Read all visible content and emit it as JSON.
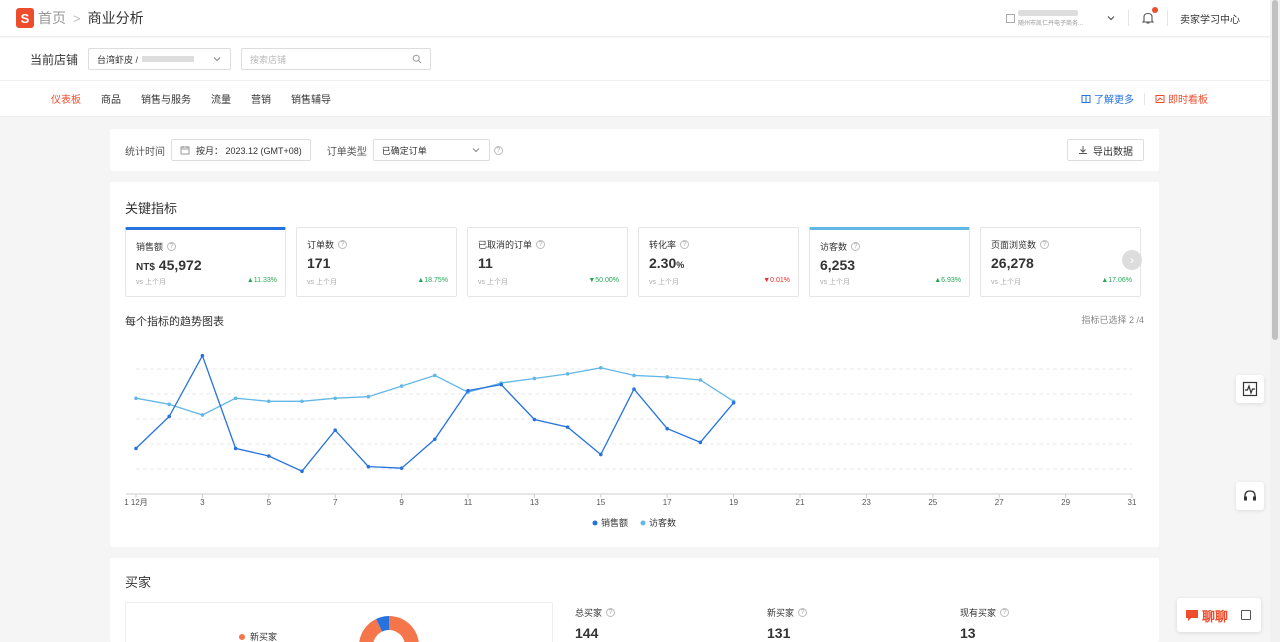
{
  "header": {
    "logo_letter": "S",
    "breadcrumb_home": "首页",
    "breadcrumb_current": "商业分析",
    "shop_subtitle": "随州市凯仁丹电子商务...",
    "learning_center": "卖家学习中心"
  },
  "store": {
    "label": "当前店铺",
    "selected": "台湾虾皮 /",
    "search_placeholder": "搜索店铺"
  },
  "tabs": [
    {
      "label": "仪表板",
      "active": true
    },
    {
      "label": "商品"
    },
    {
      "label": "销售与服务"
    },
    {
      "label": "流量"
    },
    {
      "label": "营销"
    },
    {
      "label": "销售辅导"
    }
  ],
  "tab_links": {
    "learn_more": "了解更多",
    "realtime": "即时看板"
  },
  "filter": {
    "time_label": "统计时间",
    "date_value": "按月： 2023.12 (GMT+08)",
    "order_type_label": "订单类型",
    "order_type_value": "已确定订单",
    "export_label": "导出数据"
  },
  "key_metrics": {
    "title": "关键指标",
    "vs_label": "vs 上个月",
    "items": [
      {
        "label": "销售额",
        "prefix": "NT$",
        "value": "45,972",
        "change": "11.33%",
        "direction": "up",
        "selected": "dark"
      },
      {
        "label": "订单数",
        "prefix": "",
        "value": "171",
        "change": "18.75%",
        "direction": "up"
      },
      {
        "label": "已取消的订单",
        "prefix": "",
        "value": "11",
        "change": "50.00%",
        "direction": "down-good"
      },
      {
        "label": "转化率",
        "prefix": "",
        "value": "2.30",
        "unit": "%",
        "change": "0.01%",
        "direction": "down"
      },
      {
        "label": "访客数",
        "prefix": "",
        "value": "6,253",
        "change": "6.93%",
        "direction": "up",
        "selected": "light"
      },
      {
        "label": "页面浏览数",
        "prefix": "",
        "value": "26,278",
        "change": "17.06%",
        "direction": "up"
      }
    ]
  },
  "trend": {
    "title": "每个指标的趋势图表",
    "selected_count": "指标已选择 2 /4"
  },
  "chart_data": {
    "type": "line",
    "x_tick_labels": [
      "1 12月",
      "3",
      "5",
      "7",
      "9",
      "11",
      "13",
      "15",
      "17",
      "19",
      "21",
      "23",
      "25",
      "27",
      "29",
      "31"
    ],
    "x_ticks": [
      1,
      3,
      5,
      7,
      9,
      11,
      13,
      15,
      17,
      19,
      21,
      23,
      25,
      27,
      29,
      31
    ],
    "xlim": [
      1,
      31
    ],
    "ylim": [
      0,
      100
    ],
    "grid": true,
    "legend_position": "bottom",
    "colors": {
      "sales": "#2673dd",
      "visitors": "#63b7e6"
    },
    "series": [
      {
        "name": "销售额",
        "x": [
          1,
          2,
          3,
          4,
          5,
          6,
          7,
          8,
          9,
          10,
          11,
          12,
          13,
          14,
          15,
          16,
          17,
          18,
          19
        ],
        "values": [
          30,
          51,
          91,
          30,
          25,
          15,
          42,
          18,
          17,
          36,
          68,
          72,
          49,
          44,
          26,
          69,
          43,
          34,
          60
        ]
      },
      {
        "name": "访客数",
        "x": [
          1,
          2,
          3,
          4,
          5,
          6,
          7,
          8,
          9,
          10,
          11,
          12,
          13,
          14,
          15,
          16,
          17,
          18,
          19
        ],
        "values": [
          63,
          59,
          52,
          63,
          61,
          61,
          63,
          64,
          71,
          78,
          67,
          73,
          76,
          79,
          83,
          78,
          77,
          75,
          61
        ]
      }
    ]
  },
  "buyers": {
    "title": "买家",
    "legend_new": "新买家",
    "stats": [
      {
        "label": "总买家",
        "value": "144"
      },
      {
        "label": "新买家",
        "value": "131"
      },
      {
        "label": "现有买家",
        "value": "13"
      }
    ],
    "pie_colors": [
      "#f5764b",
      "#2673dd"
    ]
  },
  "chat": {
    "label": "聊聊"
  }
}
